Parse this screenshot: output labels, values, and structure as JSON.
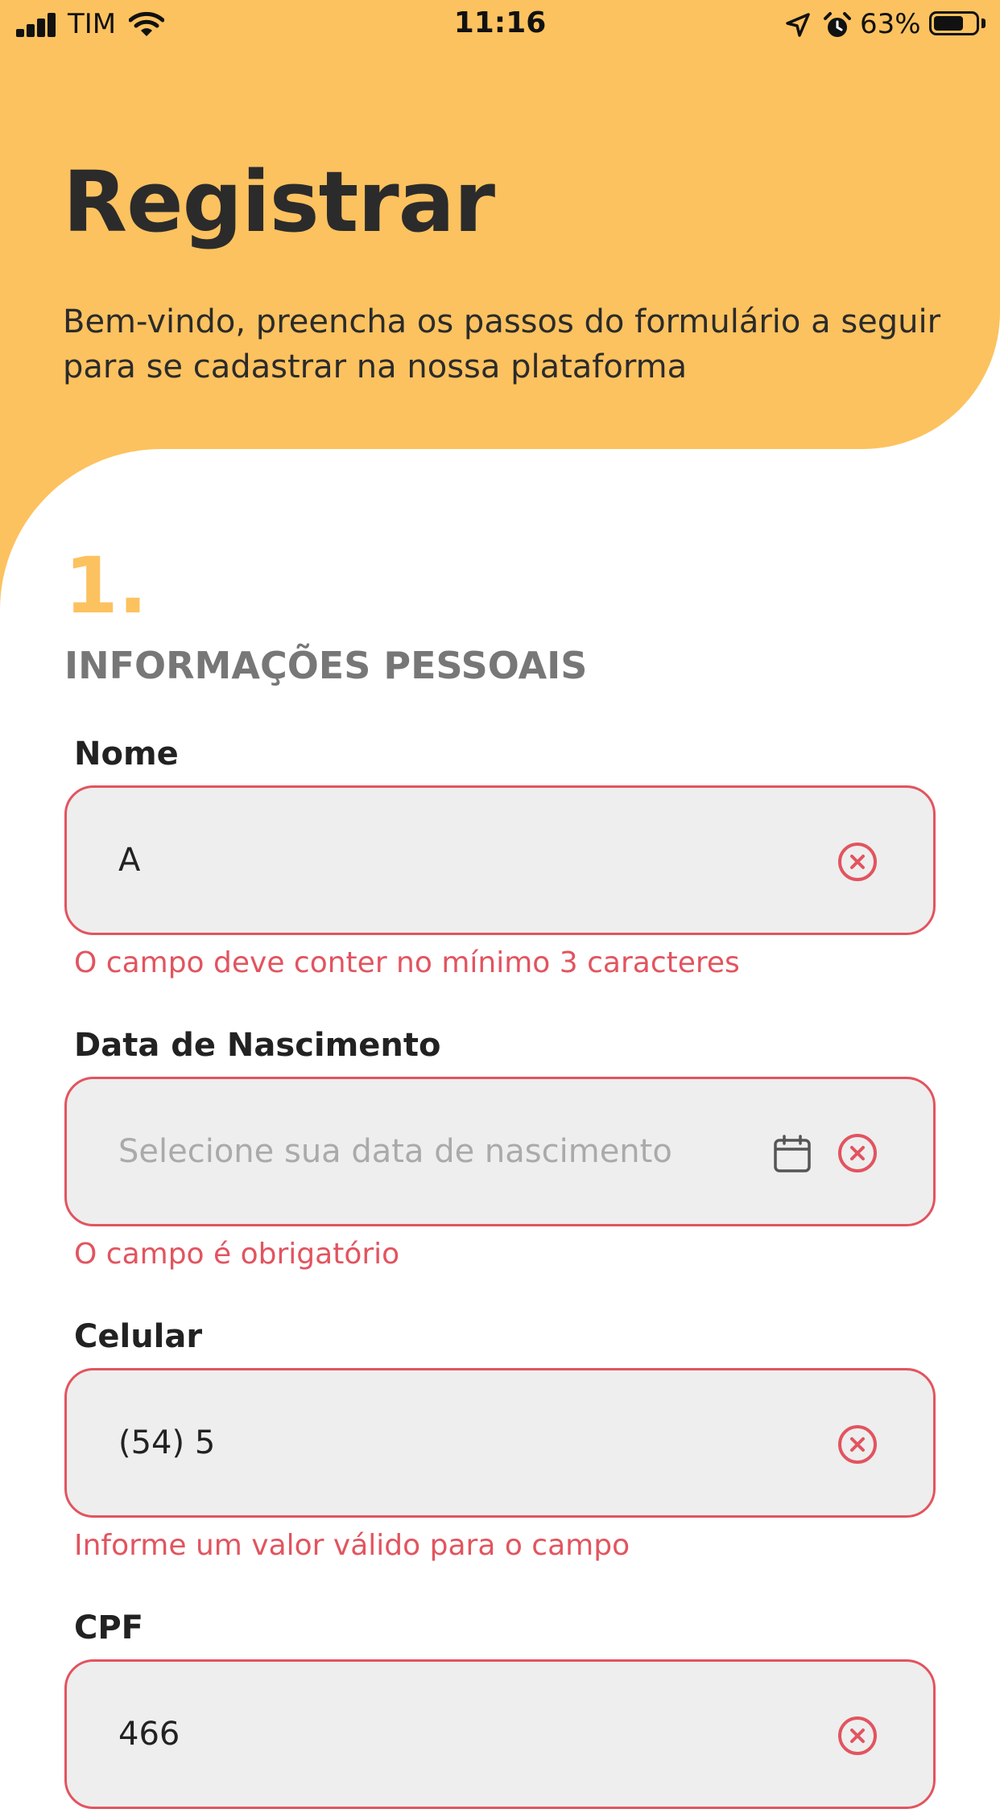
{
  "status_bar": {
    "carrier": "TIM",
    "time": "11:16",
    "battery": "63%"
  },
  "header": {
    "title": "Registrar",
    "subtitle": "Bem-vindo, preencha os passos do formulário a seguir para se cadastrar na nossa plataforma"
  },
  "step": {
    "number": "1.",
    "title": "INFORMAÇÕES PESSOAIS"
  },
  "fields": {
    "nome": {
      "label": "Nome",
      "value": "A",
      "error": "O campo deve conter no mínimo 3 caracteres"
    },
    "nascimento": {
      "label": "Data de Nascimento",
      "placeholder": "Selecione sua data de nascimento",
      "error": "O campo é obrigatório"
    },
    "celular": {
      "label": "Celular",
      "value": "(54) 5",
      "error": "Informe um valor válido para o campo"
    },
    "cpf": {
      "label": "CPF",
      "value": "466"
    }
  },
  "colors": {
    "accent": "#FCC25F",
    "error": "#E2545F",
    "field_bg": "#EEEEEE"
  },
  "icons": [
    "signal-icon",
    "wifi-icon",
    "location-icon",
    "alarm-icon",
    "battery-icon",
    "clear-icon",
    "calendar-icon"
  ]
}
